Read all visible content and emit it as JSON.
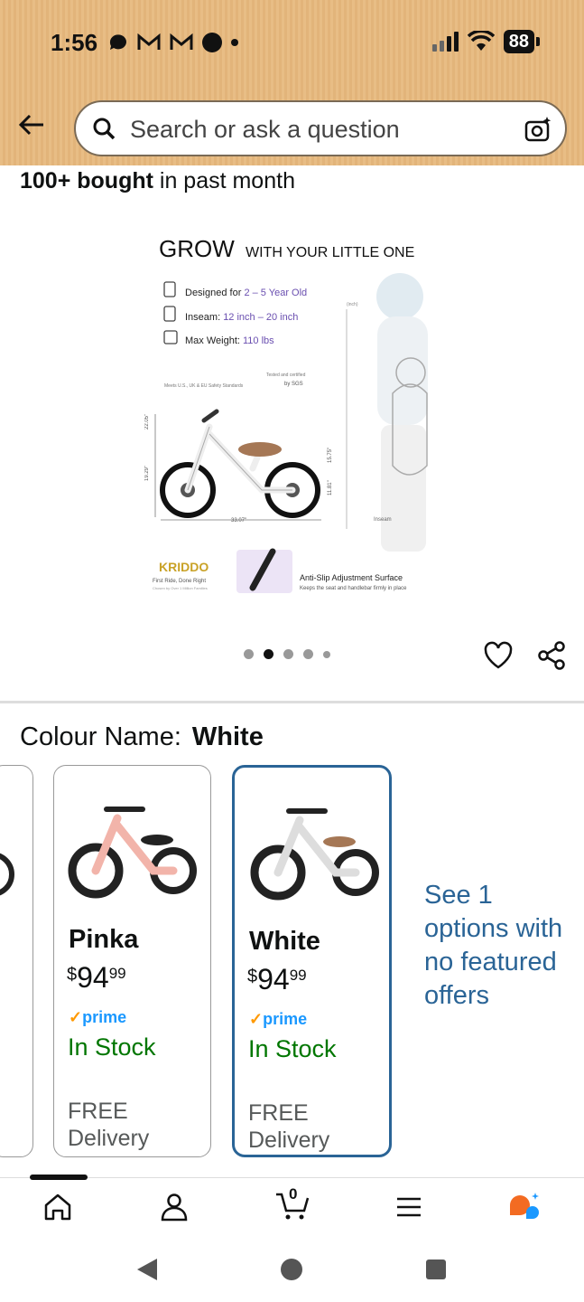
{
  "status_bar": {
    "time": "1:56",
    "notif_icons": [
      "chat-bubble-icon",
      "gmail-icon",
      "gmail-icon",
      "record-dot-icon",
      "dot-icon"
    ],
    "battery": "88"
  },
  "search": {
    "placeholder": "Search or ask a question"
  },
  "product": {
    "bought_bold": "100+ bought",
    "bought_rest": " in past month"
  },
  "image_text": {
    "headline_big": "GROW",
    "headline_small": "WITH YOUR LITTLE ONE",
    "designed_label": "Designed for ",
    "designed_value": "2 – 5 Year Old",
    "inseam_label": "Inseam: ",
    "inseam_value": "12 inch – 20 inch",
    "weight_label": "Max Weight: ",
    "weight_value": "110 lbs",
    "cert_left": "Meets U.S., UK & EU Safety Standards",
    "cert_right1": "Tested and certified",
    "cert_right2": "by SGS",
    "dim_height": "22.05\"",
    "dim_seat": "19.29\"",
    "dim_length": "33.07\"",
    "dim_handle": "15.75\"",
    "dim_seat2": "11.81\"",
    "ruler_unit": "(inch)",
    "inseam_tag": "Inseam",
    "brand": "KRIDDO",
    "brand_tag1": "First Ride, Done Right",
    "brand_tag2": "Chosen by Over 1 Million Families",
    "feature_title": "Anti-Slip Adjustment Surface",
    "feature_sub": "Keeps the seat and handlebar firmly in place"
  },
  "carousel": {
    "total": 5,
    "active": 2
  },
  "colour": {
    "label": "Colour Name:",
    "value": "White"
  },
  "variants": [
    {
      "name": "Pinka",
      "currency": "$",
      "whole": "94",
      "cents": "99",
      "prime": "prime",
      "stock": "In Stock",
      "free": "FREE",
      "delivery": "Delivery",
      "selected": false
    },
    {
      "name": "White",
      "currency": "$",
      "whole": "94",
      "cents": "99",
      "prime": "prime",
      "stock": "In Stock",
      "free": "FREE",
      "delivery": "Delivery",
      "selected": true
    }
  ],
  "see_more": "See 1 options with no featured offers",
  "bottom_nav": [
    "home-icon",
    "account-icon",
    "cart-icon",
    "menu-icon",
    "rufus-icon"
  ],
  "cart_count": "0",
  "colors": {
    "selected_border": "#2a6496",
    "in_stock": "#007600",
    "link": "#2a6496",
    "prime": "#1a98ff",
    "header_bg": "#e8bd85"
  }
}
